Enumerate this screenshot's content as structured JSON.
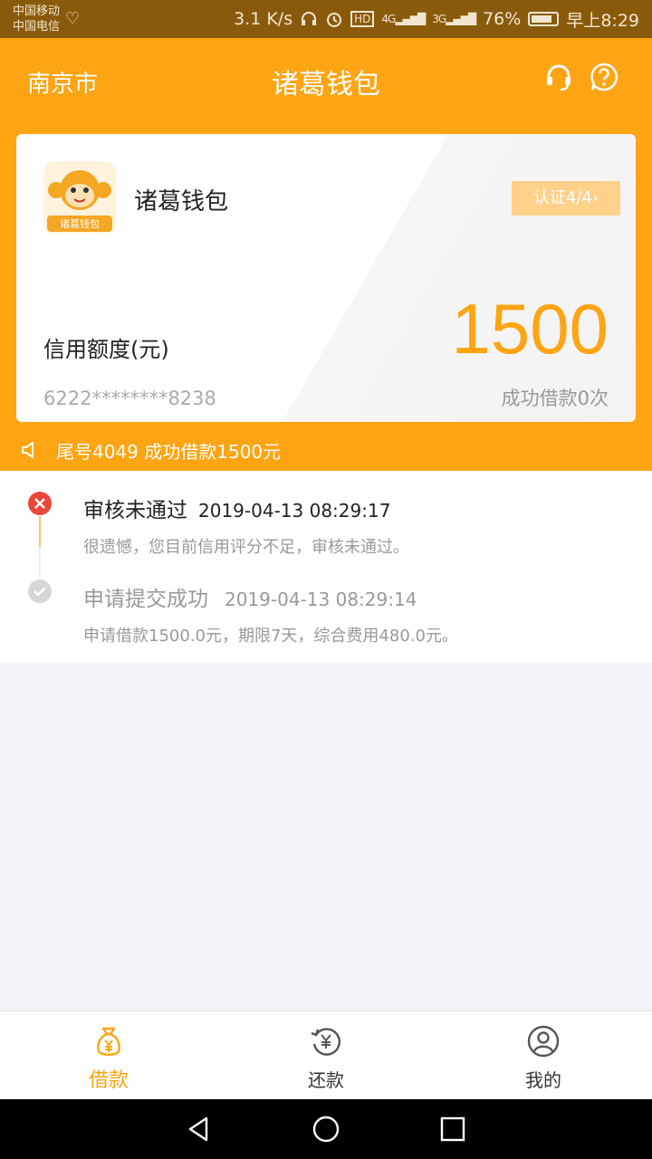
{
  "status_bar": {
    "carrier1": "中国移动",
    "carrier2": "中国电信",
    "speed": "3.1 K/s",
    "hd": "HD",
    "net1": "4G",
    "net2": "3G",
    "battery": "76%",
    "time": "早上8:29"
  },
  "header": {
    "city": "南京市",
    "title": "诸葛钱包"
  },
  "card": {
    "name": "诸葛钱包",
    "logo_text": "诸葛钱包",
    "cert_label": "认证4/4",
    "credit_label": "信用额度(元)",
    "amount": "1500",
    "card_number": "6222********8238",
    "borrow_count": "成功借款0次"
  },
  "notice": {
    "text": "尾号4049 成功借款1500元"
  },
  "timeline": [
    {
      "title": "审核未通过",
      "time": "2019-04-13 08:29:17",
      "desc": "很遗憾，您目前信用评分不足，审核未通过。",
      "status": "failed"
    },
    {
      "title": "申请提交成功",
      "time": "2019-04-13 08:29:14",
      "desc": "申请借款1500.0元，期限7天，综合费用480.0元。",
      "status": "done"
    }
  ],
  "bottom_nav": {
    "items": [
      {
        "label": "借款",
        "icon": "money-bag-icon",
        "active": true
      },
      {
        "label": "还款",
        "icon": "repay-icon",
        "active": false
      },
      {
        "label": "我的",
        "icon": "profile-icon",
        "active": false
      }
    ]
  },
  "colors": {
    "brand": "#ffa412",
    "fail": "#e9473a"
  }
}
